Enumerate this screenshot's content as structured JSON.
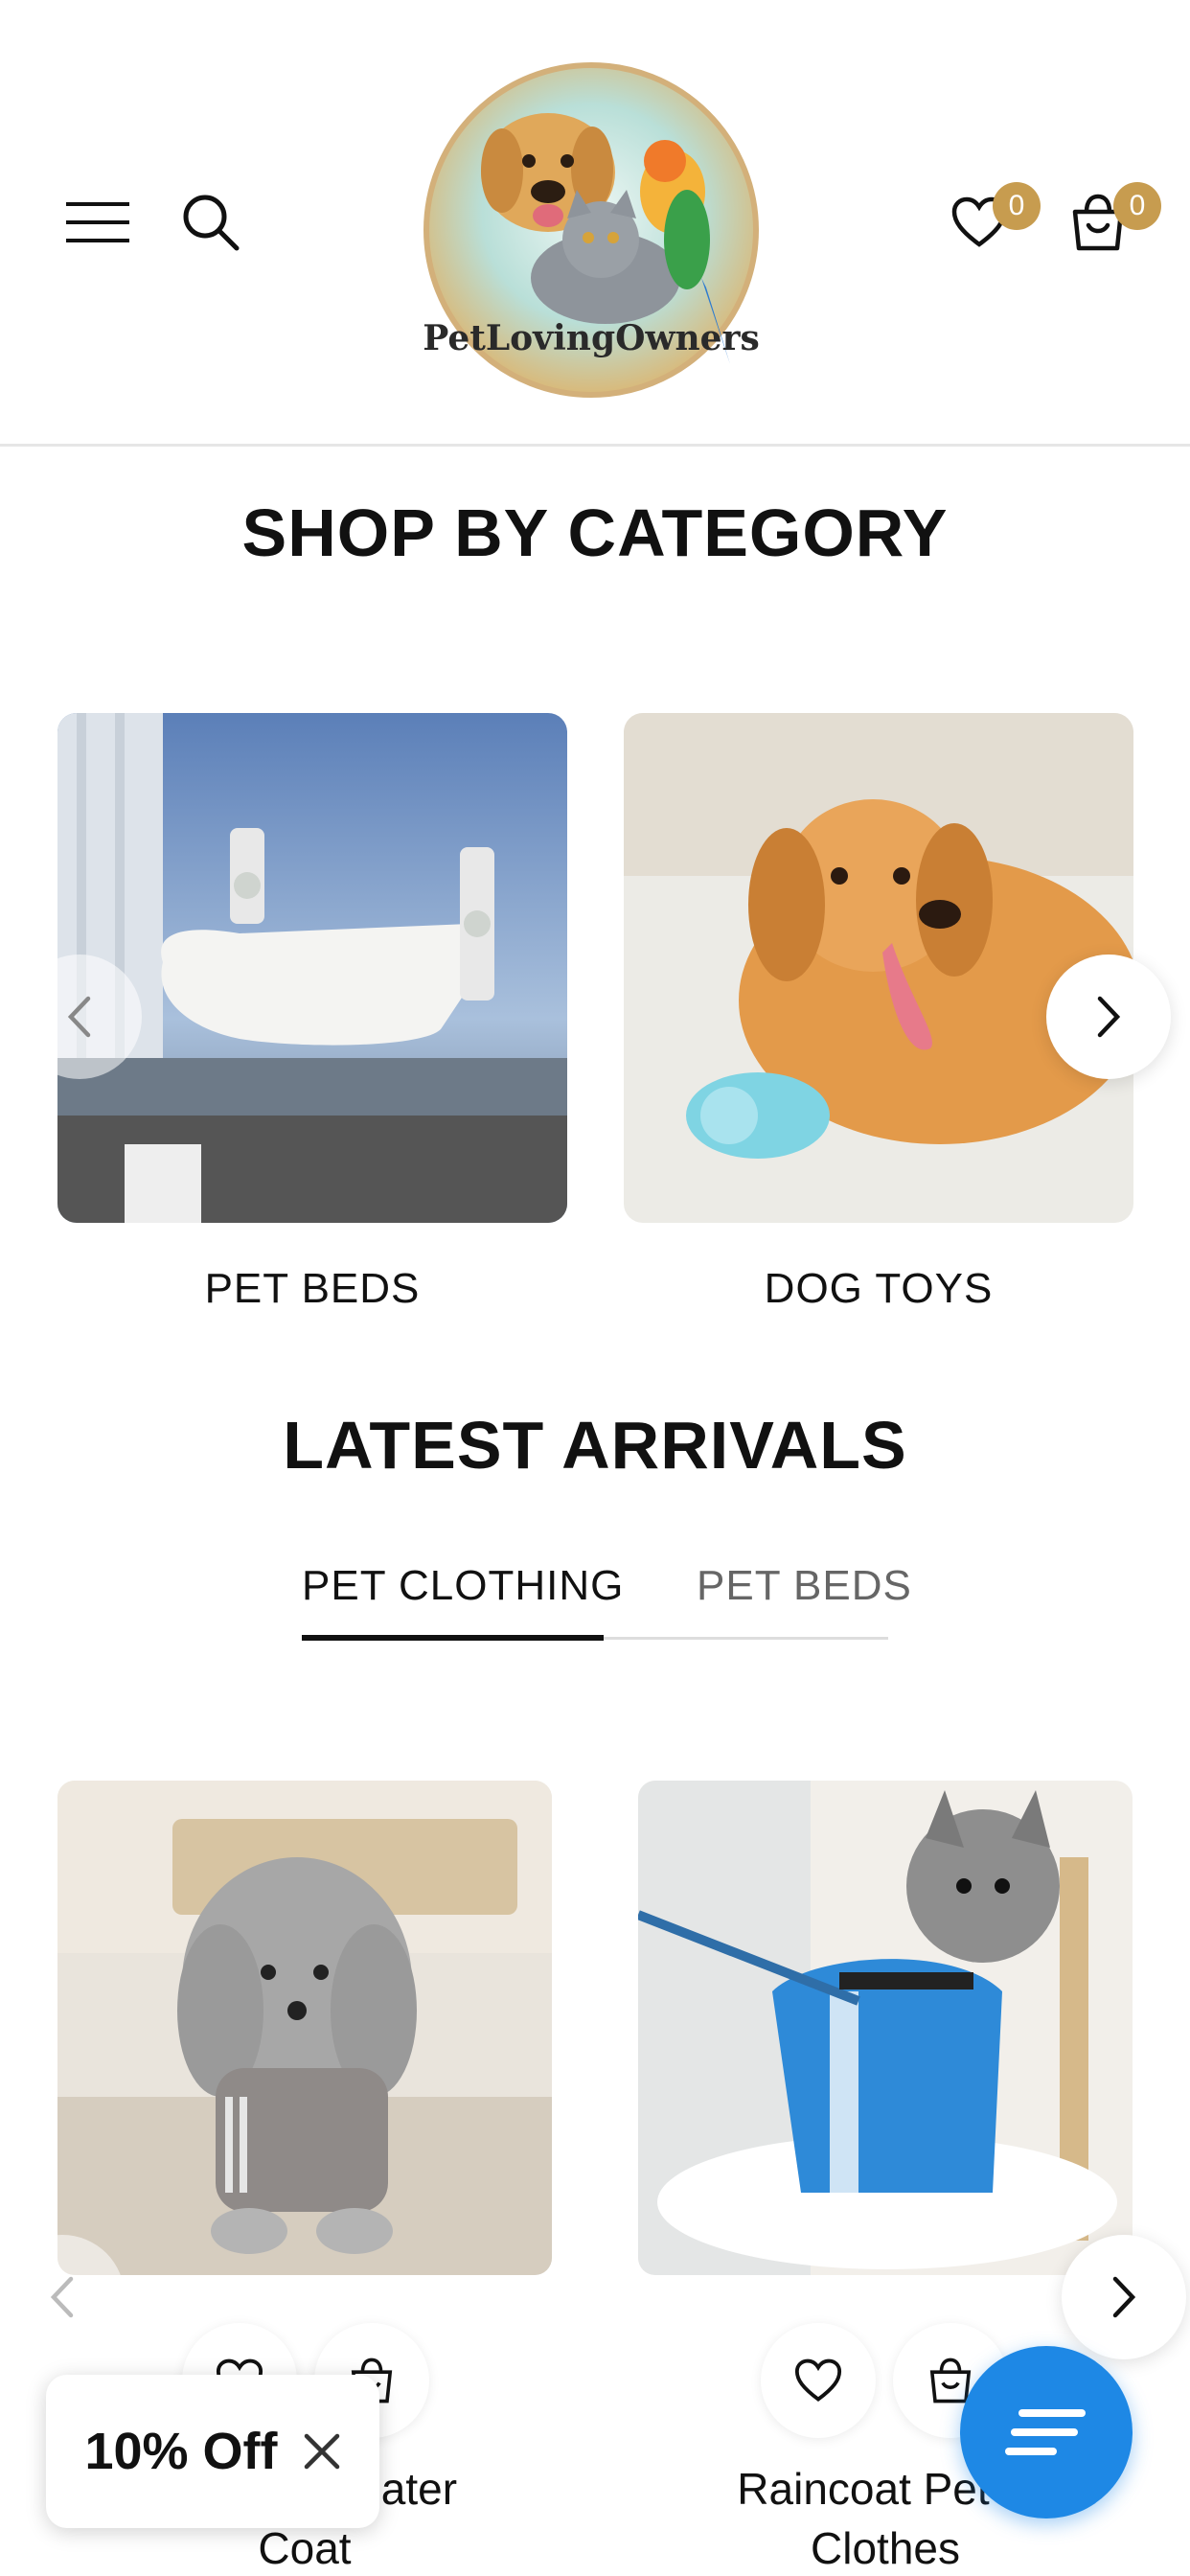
{
  "header": {
    "logo_text": "PetLovingOwners",
    "wishlist_count": "0",
    "cart_count": "0",
    "icons": [
      "menu-icon",
      "search-icon",
      "heart-icon",
      "shopping-bag-icon"
    ]
  },
  "categories": {
    "title": "SHOP BY CATEGORY",
    "items": [
      {
        "label": "PET BEDS"
      },
      {
        "label": "DOG TOYS"
      }
    ]
  },
  "latest": {
    "title": "LATEST ARRIVALS",
    "tabs": [
      {
        "label": "PET CLOTHING",
        "active": true
      },
      {
        "label": "PET BEDS",
        "active": false
      }
    ],
    "products": [
      {
        "name_line1": "weater",
        "name_line2": "Coat"
      },
      {
        "name_line1": "Raincoat Pet D",
        "name_line2": "Clothes"
      }
    ]
  },
  "popup": {
    "discount_label": "10% Off"
  },
  "colors": {
    "badge": "#c79c4f",
    "chat": "#1e88e5",
    "text": "#111111"
  }
}
